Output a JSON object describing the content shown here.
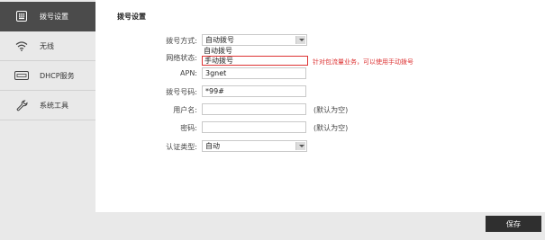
{
  "sidebar": {
    "items": [
      {
        "label": "拨号设置",
        "icon": "dialpad-icon"
      },
      {
        "label": "无线",
        "icon": "wifi-icon"
      },
      {
        "label": "DHCP服务",
        "icon": "dhcp-icon"
      },
      {
        "label": "系统工具",
        "icon": "wrench-icon"
      }
    ]
  },
  "main": {
    "title": "拨号设置",
    "form": {
      "dial_mode": {
        "label": "拨号方式:",
        "value": "自动拨号"
      },
      "network_status": {
        "label": "网络状态:",
        "options": [
          "自动拨号",
          "手动拨号"
        ],
        "selected": "手动拨号"
      },
      "warning": "针对包流量业务，可以使用手动拨号",
      "apn": {
        "label": "APN:",
        "value": "3gnet"
      },
      "dial_number": {
        "label": "拨号号码:",
        "value": "*99#"
      },
      "username": {
        "label": "用户名:",
        "value": "",
        "hint": "(默认为空)"
      },
      "password": {
        "label": "密码:",
        "value": "",
        "hint": "(默认为空)"
      },
      "auth_type": {
        "label": "认证类型:",
        "value": "自动"
      }
    }
  },
  "footer": {
    "save_label": "保存"
  },
  "colors": {
    "active_nav": "#4b4b4b",
    "warning": "#dd3333",
    "save_button": "#2f2f2f"
  }
}
